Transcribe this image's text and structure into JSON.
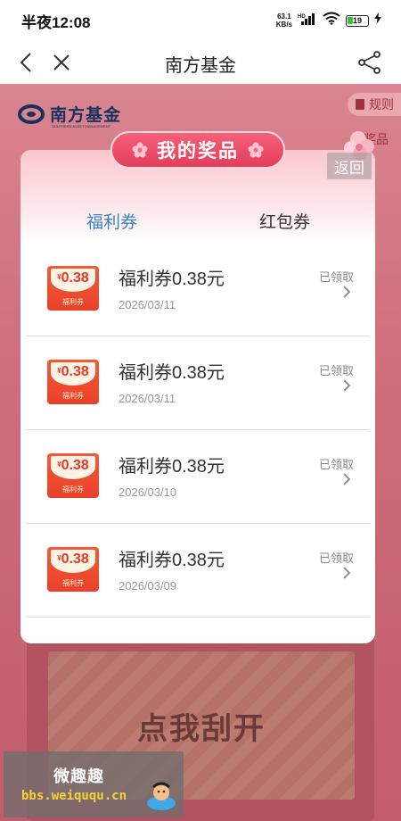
{
  "status_bar": {
    "time": "半夜12:08",
    "net_speed_value": "63.1",
    "net_speed_unit": "KB/s",
    "signal_tag": "HD",
    "battery": "19"
  },
  "nav": {
    "title": "南方基金"
  },
  "page": {
    "logo_text": "南方基金",
    "logo_sub": "SOUTHERN ASSET MANAGEMENT",
    "rules_label": "规则",
    "prizes_label": "奖品",
    "scratch_label": "点我刮开"
  },
  "modal": {
    "title": "我的奖品",
    "return_label": "返回",
    "tabs": [
      {
        "label": "福利券",
        "active": true
      },
      {
        "label": "红包券",
        "active": false
      }
    ],
    "items": [
      {
        "coupon_value": "0.38",
        "coupon_label": "福利券",
        "name": "福利券0.38元",
        "date": "2026/03/11",
        "status": "已领取"
      },
      {
        "coupon_value": "0.38",
        "coupon_label": "福利券",
        "name": "福利券0.38元",
        "date": "2026/03/11",
        "status": "已领取"
      },
      {
        "coupon_value": "0.38",
        "coupon_label": "福利券",
        "name": "福利券0.38元",
        "date": "2026/03/10",
        "status": "已领取"
      },
      {
        "coupon_value": "0.38",
        "coupon_label": "福利券",
        "name": "福利券0.38元",
        "date": "2026/03/09",
        "status": "已领取"
      }
    ]
  },
  "watermark": {
    "title": "微趣趣",
    "url": "bbs.weiququ.cn"
  },
  "colors": {
    "accent_tab": "#3b82c4",
    "ribbon": "#e23d5a",
    "coupon": "#e9412a",
    "page_bg": "#cf6d7b"
  },
  "icons": [
    "back-icon",
    "close-icon",
    "share-icon",
    "wifi-icon",
    "signal-icon",
    "flower-icon",
    "chevron-right-icon",
    "rules-book-icon"
  ]
}
